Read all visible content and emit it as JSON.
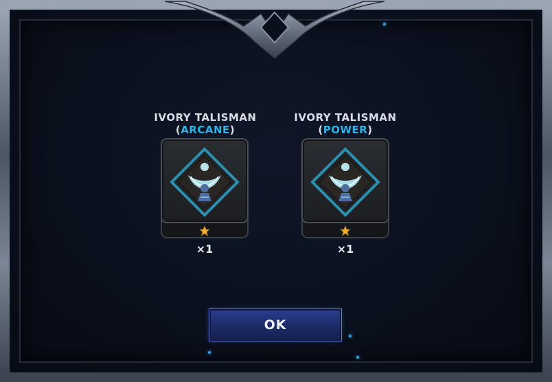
{
  "rewards": [
    {
      "name_line": "IVORY TALISMAN",
      "type_open": "(",
      "type": "ARCANE",
      "type_close": ")",
      "icon": "talisman-icon",
      "stars": 1,
      "quantity": "×1"
    },
    {
      "name_line": "IVORY TALISMAN",
      "type_open": "(",
      "type": "POWER",
      "type_close": ")",
      "icon": "talisman-icon",
      "stars": 1,
      "quantity": "×1"
    }
  ],
  "ok_label": "OK",
  "colors": {
    "accent": "#2db3e6",
    "button": "#22357a",
    "frame": "#6b7482",
    "star": "#f2b233"
  }
}
